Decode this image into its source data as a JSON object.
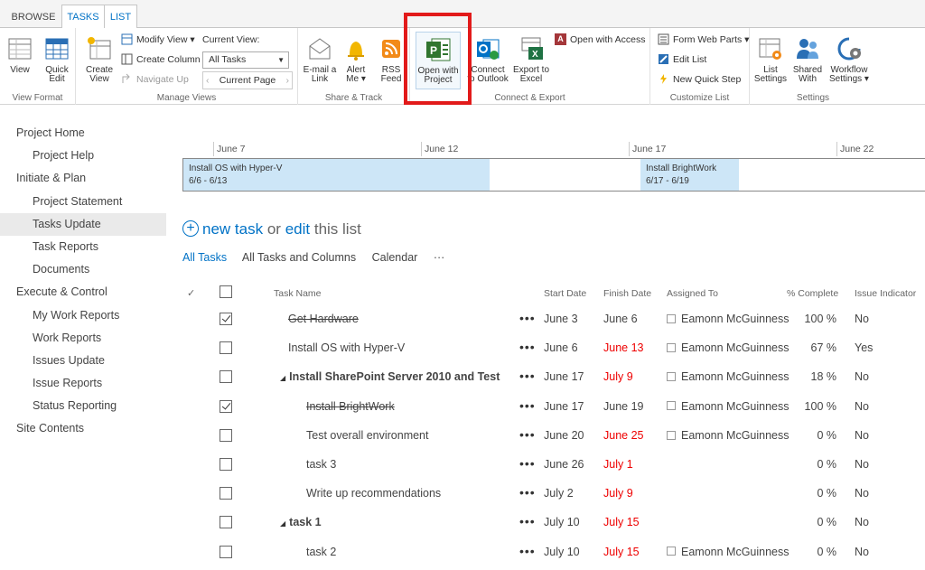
{
  "tabs": [
    "BROWSE",
    "TASKS",
    "LIST"
  ],
  "ribbon": {
    "view": "View",
    "quick_edit": "Quick Edit",
    "group_view_format": "View Format",
    "create_view": "Create View",
    "modify_view": "Modify View",
    "create_column": "Create Column",
    "navigate_up": "Navigate Up",
    "current_view_label": "Current View:",
    "current_view_value": "All Tasks",
    "current_page": "Current Page",
    "group_manage_views": "Manage Views",
    "email_link": "E-mail a Link",
    "alert_me": "Alert Me",
    "rss_feed": "RSS Feed",
    "group_share_track": "Share & Track",
    "open_with_project": "Open with Project",
    "connect_outlook": "Connect to Outlook",
    "export_excel": "Export to Excel",
    "open_access": "Open with Access",
    "group_connect_export": "Connect & Export",
    "form_web_parts": "Form Web Parts",
    "edit_list": "Edit List",
    "new_quick_step": "New Quick Step",
    "group_customize_list": "Customize List",
    "list_settings": "List Settings",
    "shared_with": "Shared With",
    "workflow_settings": "Workflow Settings",
    "group_settings": "Settings"
  },
  "nav": [
    {
      "label": "Project Home",
      "sub": false
    },
    {
      "label": "Project Help",
      "sub": true
    },
    {
      "label": "Initiate & Plan",
      "sub": false
    },
    {
      "label": "Project Statement",
      "sub": true
    },
    {
      "label": "Tasks Update",
      "sub": true,
      "selected": true
    },
    {
      "label": "Task Reports",
      "sub": true
    },
    {
      "label": "Documents",
      "sub": true
    },
    {
      "label": "Execute & Control",
      "sub": false
    },
    {
      "label": "My Work Reports",
      "sub": true
    },
    {
      "label": "Work Reports",
      "sub": true
    },
    {
      "label": "Issues Update",
      "sub": true
    },
    {
      "label": "Issue Reports",
      "sub": true
    },
    {
      "label": "Status Reporting",
      "sub": true
    },
    {
      "label": "Site Contents",
      "sub": false
    }
  ],
  "timeline": {
    "dates": [
      "June 7",
      "June 12",
      "June 17",
      "June 22"
    ],
    "events": [
      {
        "name": "Install OS with Hyper-V",
        "range": "6/6 - 6/13"
      },
      {
        "name": "Install BrightWork",
        "range": "6/17 - 6/19"
      }
    ]
  },
  "newtask": {
    "new_task": "new task",
    "or": "or",
    "edit": "edit",
    "this_list": "this list"
  },
  "views": [
    "All Tasks",
    "All Tasks and Columns",
    "Calendar",
    "···"
  ],
  "columns": {
    "task_name": "Task Name",
    "start": "Start Date",
    "finish": "Finish Date",
    "assigned": "Assigned To",
    "pct": "% Complete",
    "issue": "Issue Indicator"
  },
  "rows": [
    {
      "checked": true,
      "name": "Get Hardware",
      "indent": 1,
      "done": true,
      "bold": false,
      "start": "June 3",
      "finish": "June 6",
      "late": false,
      "assigned": "Eamonn McGuinness",
      "pct": "100 %",
      "issue": "No"
    },
    {
      "checked": false,
      "name": "Install OS with Hyper-V",
      "indent": 1,
      "done": false,
      "bold": false,
      "start": "June 6",
      "finish": "June 13",
      "late": true,
      "assigned": "Eamonn McGuinness",
      "pct": "67 %",
      "issue": "Yes"
    },
    {
      "checked": false,
      "name": "Install SharePoint Server 2010 and Test",
      "indent": 0,
      "done": false,
      "bold": true,
      "start": "June 17",
      "finish": "July 9",
      "late": true,
      "assigned": "Eamonn McGuinness",
      "pct": "18 %",
      "issue": "No"
    },
    {
      "checked": true,
      "name": "Install BrightWork",
      "indent": 2,
      "done": true,
      "bold": false,
      "start": "June 17",
      "finish": "June 19",
      "late": false,
      "assigned": "Eamonn McGuinness",
      "pct": "100 %",
      "issue": "No"
    },
    {
      "checked": false,
      "name": "Test overall environment",
      "indent": 2,
      "done": false,
      "bold": false,
      "start": "June 20",
      "finish": "June 25",
      "late": true,
      "assigned": "Eamonn McGuinness",
      "pct": "0 %",
      "issue": "No"
    },
    {
      "checked": false,
      "name": "task 3",
      "indent": 2,
      "done": false,
      "bold": false,
      "start": "June 26",
      "finish": "July 1",
      "late": true,
      "assigned": "",
      "pct": "0 %",
      "issue": "No"
    },
    {
      "checked": false,
      "name": "Write up recommendations",
      "indent": 2,
      "done": false,
      "bold": false,
      "start": "July 2",
      "finish": "July 9",
      "late": true,
      "assigned": "",
      "pct": "0 %",
      "issue": "No"
    },
    {
      "checked": false,
      "name": "task 1",
      "indent": 0,
      "done": false,
      "bold": true,
      "start": "July 10",
      "finish": "July 15",
      "late": true,
      "assigned": "",
      "pct": "0 %",
      "issue": "No"
    },
    {
      "checked": false,
      "name": "task 2",
      "indent": 2,
      "done": false,
      "bold": false,
      "start": "July 10",
      "finish": "July 15",
      "late": true,
      "assigned": "Eamonn McGuinness",
      "pct": "0 %",
      "issue": "No"
    }
  ]
}
